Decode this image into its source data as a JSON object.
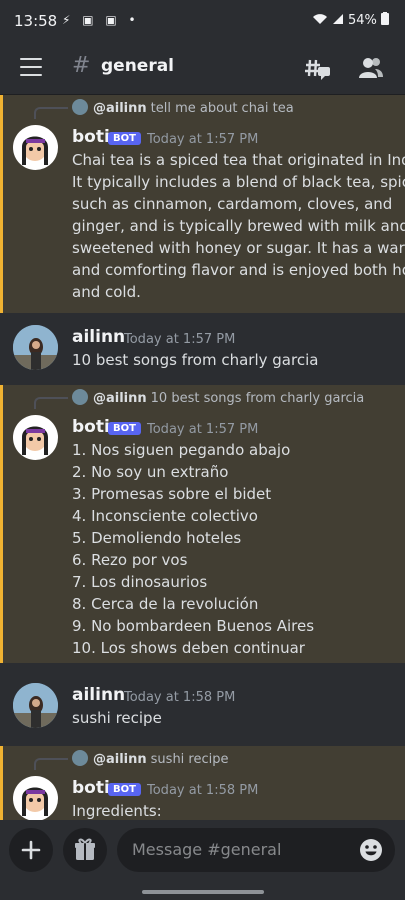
{
  "status_bar": {
    "time": "13:58",
    "icons": "⚡ ▣ ▣ •",
    "signal": "54%"
  },
  "header": {
    "hash": "#",
    "channel": "general"
  },
  "messages": [
    {
      "reply_user": "@ailinn",
      "reply_text": "tell me about chai tea",
      "user": "boti",
      "badge": "BOT",
      "time": "Today at 1:57 PM",
      "lines": [
        "Chai tea is a spiced tea that originated in India.",
        "It typically includes a blend of black tea, spices",
        "such as cinnamon, cardamom, cloves, and",
        "ginger, and is typically brewed with milk and",
        "sweetened with honey or sugar. It has a warm",
        "and comforting flavor and is enjoyed both hot",
        "and cold."
      ]
    },
    {
      "user": "ailinn",
      "time": "Today at 1:57 PM",
      "lines": [
        "10 best songs from charly garcia"
      ]
    },
    {
      "reply_user": "@ailinn",
      "reply_text": "10 best songs from charly garcia",
      "user": "boti",
      "badge": "BOT",
      "time": "Today at 1:57 PM",
      "lines": [
        "1. Nos siguen pegando abajo",
        "2. No soy un extraño",
        "3. Promesas sobre el bidet",
        "4. Inconsciente colectivo",
        "5. Demoliendo hoteles",
        "6. Rezo por vos",
        "7. Los dinosaurios",
        "8. Cerca de la revolución",
        "9. No bombardeen Buenos Aires",
        "10. Los shows deben continuar"
      ]
    },
    {
      "user": "ailinn",
      "time": "Today at 1:58 PM",
      "lines": [
        "sushi recipe"
      ]
    },
    {
      "reply_user": "@ailinn",
      "reply_text": "sushi recipe",
      "user": "boti",
      "badge": "BOT",
      "time": "Today at 1:58 PM",
      "lines": [
        "Ingredients:"
      ]
    }
  ],
  "composer": {
    "placeholder": "Message #general"
  }
}
